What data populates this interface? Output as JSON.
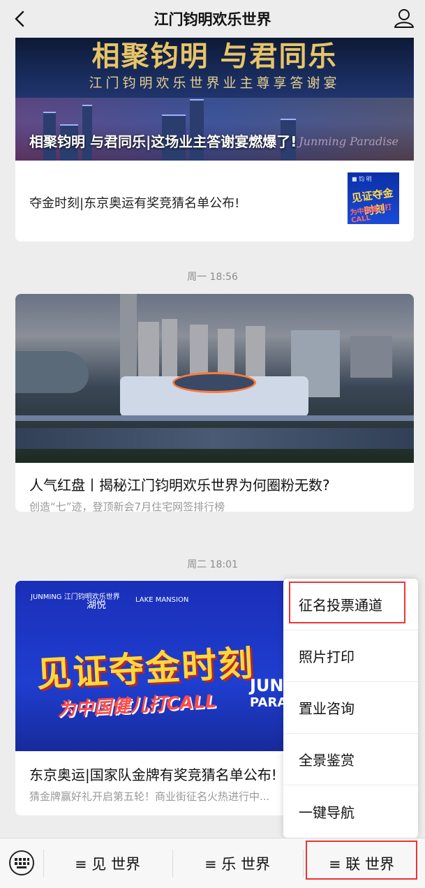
{
  "header": {
    "title": "江门钧明欢乐世界"
  },
  "feed": {
    "cardA": {
      "banner_big": "相聚钧明 与君同乐",
      "banner_sub": "江门钧明欢乐世界业主尊享答谢宴",
      "banner_caption": "相聚钧明 与君同乐|这场业主答谢宴燃爆了!",
      "banner_script": "Junming Paradise",
      "sub_title": "夺金时刻|东京奥运有奖竞猜名单公布!",
      "thumb_top": "■ 钧 明",
      "thumb_main": "见证夺金时刻",
      "thumb_red": "为中国健儿打CALL"
    },
    "time1": "周一 18:56",
    "cardB": {
      "title": "人气红盘丨揭秘江门钧明欢乐世界为何圈粉无数?",
      "desc": "创造“七”迹，登顶新会7月住宅网签排行榜"
    },
    "time2": "周二 18:01",
    "cardC": {
      "logo": "JUNMING 江门钧明欢乐世界",
      "lake_cn": "湖悦",
      "lake_en": "LAKE MANSION",
      "big": "见证夺金时刻",
      "red": "为中国健儿打CALL",
      "jun": "JUNMI",
      "par": "PARAD",
      "title": "东京奥运|国家队金牌有奖竞猜名单公布!",
      "desc": "猜金牌赢好礼开启第五轮！商业街征名火热进行中..."
    }
  },
  "menu": {
    "items": [
      "征名投票通道",
      "照片打印",
      "置业咨询",
      "全景鉴赏",
      "一键导航"
    ]
  },
  "tabbar": {
    "tabs": [
      "≡ 见 世界",
      "≡ 乐 世界",
      "≡ 联 世界"
    ]
  },
  "icons": {
    "back": "chevron-left-icon",
    "user": "user-icon",
    "keyboard": "keyboard-icon"
  },
  "colors": {
    "highlight": "#ee3333",
    "background": "#ededed"
  }
}
